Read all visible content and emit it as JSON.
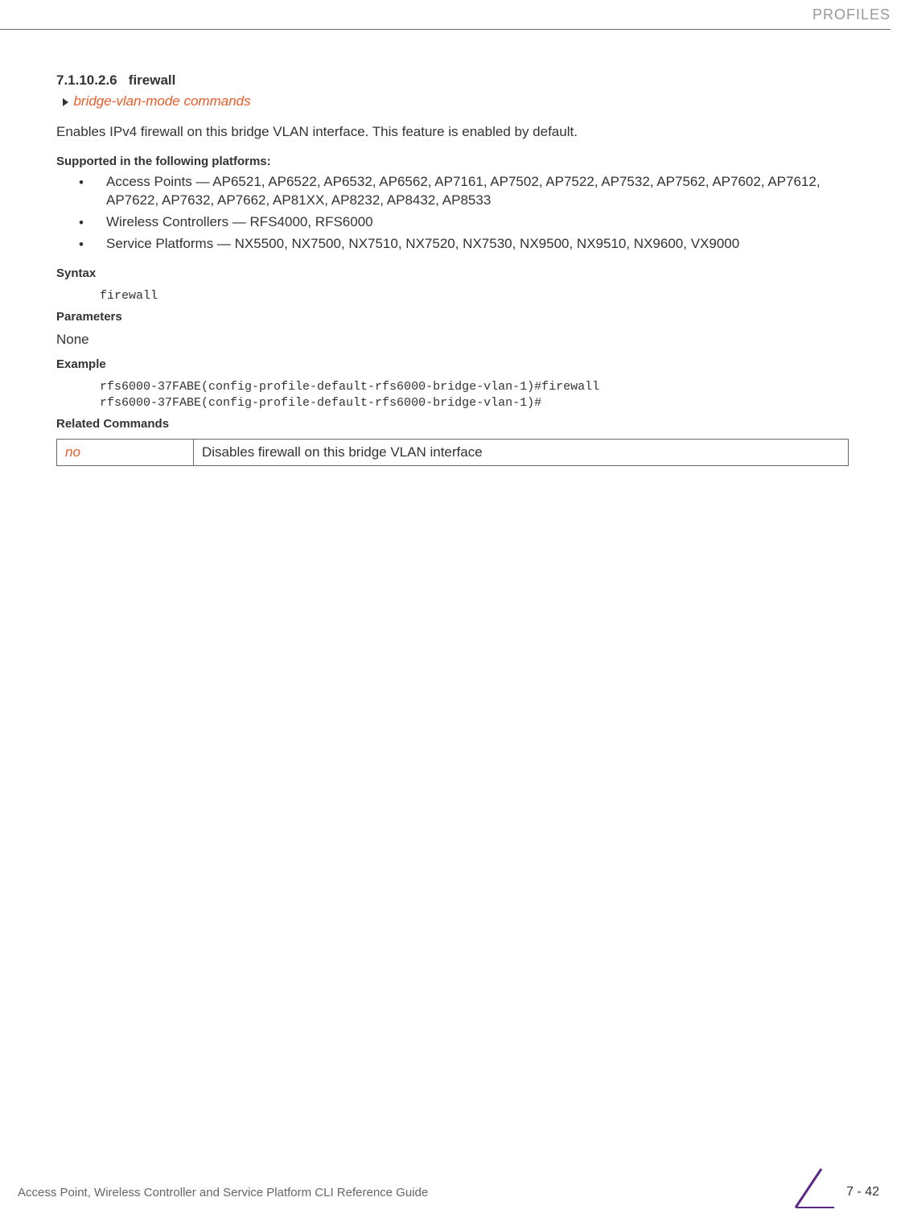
{
  "header": {
    "category": "PROFILES"
  },
  "section": {
    "number": "7.1.10.2.6",
    "title": "firewall",
    "breadcrumb": "bridge-vlan-mode commands",
    "intro": "Enables IPv4 firewall on this bridge VLAN interface. This feature is enabled by default."
  },
  "supported": {
    "heading": "Supported in the following platforms:",
    "items": [
      "Access Points — AP6521, AP6522, AP6532, AP6562, AP7161, AP7502, AP7522, AP7532, AP7562, AP7602, AP7612, AP7622, AP7632, AP7662, AP81XX, AP8232, AP8432, AP8533",
      "Wireless Controllers — RFS4000, RFS6000",
      "Service Platforms — NX5500, NX7500, NX7510, NX7520, NX7530, NX9500, NX9510, NX9600, VX9000"
    ]
  },
  "syntax": {
    "heading": "Syntax",
    "code": "firewall"
  },
  "parameters": {
    "heading": "Parameters",
    "value": "None"
  },
  "example": {
    "heading": "Example",
    "code": "rfs6000-37FABE(config-profile-default-rfs6000-bridge-vlan-1)#firewall\nrfs6000-37FABE(config-profile-default-rfs6000-bridge-vlan-1)#"
  },
  "related": {
    "heading": "Related Commands",
    "rows": [
      {
        "cmd": "no",
        "desc": "Disables firewall on this bridge VLAN interface"
      }
    ]
  },
  "footer": {
    "guide": "Access Point, Wireless Controller and Service Platform CLI Reference Guide",
    "page": "7 - 42"
  }
}
